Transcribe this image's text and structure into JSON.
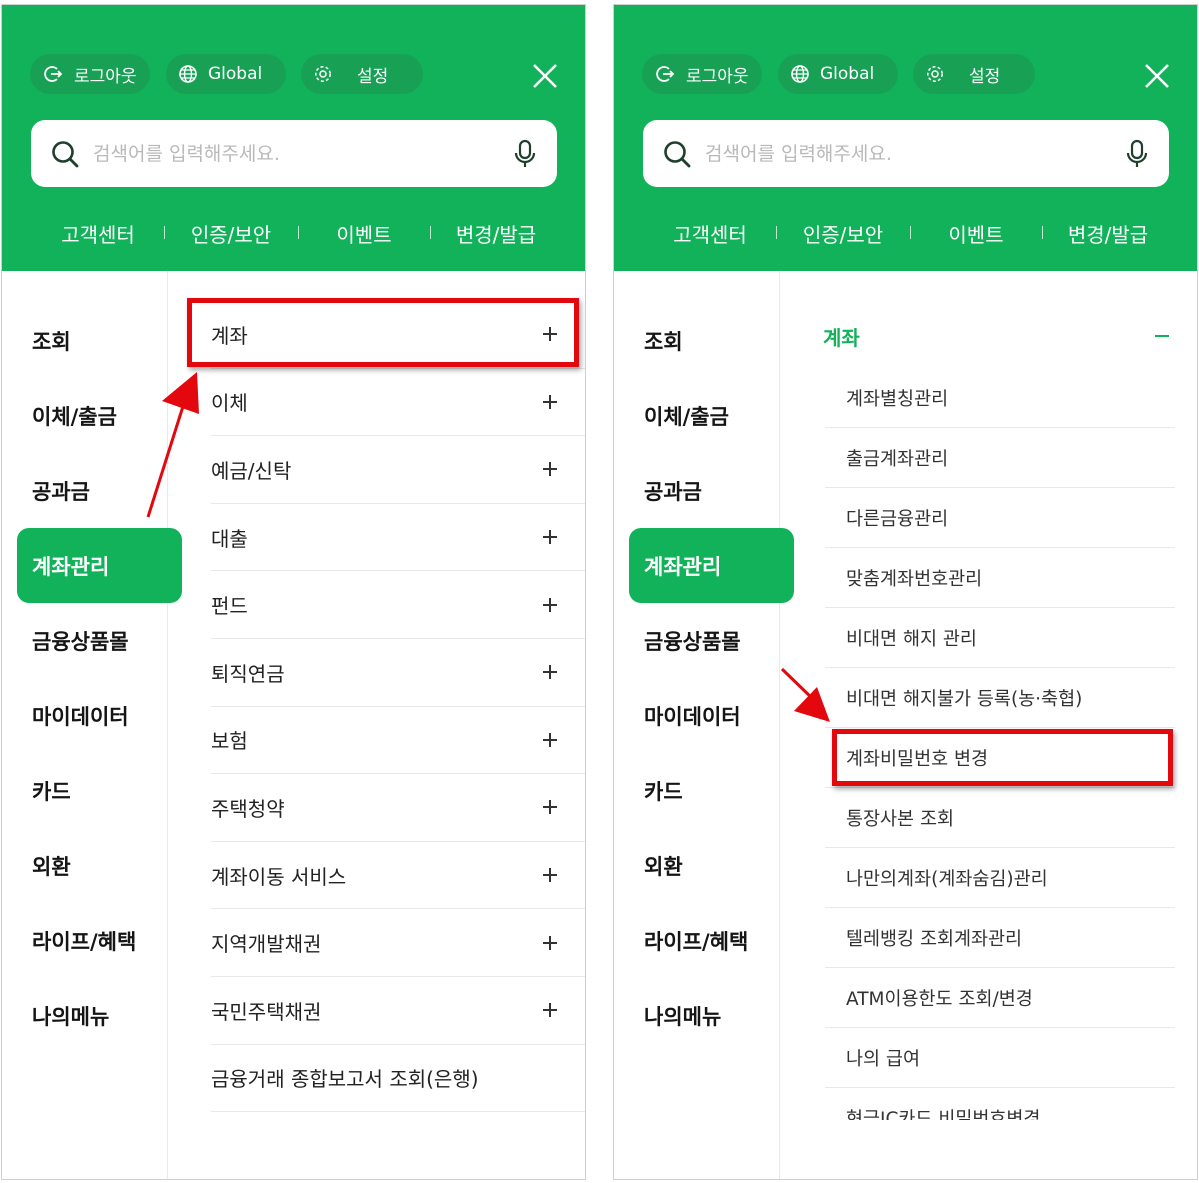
{
  "panels": {
    "left": {
      "header": {
        "logout": "로그아웃",
        "global": "Global",
        "settings": "설정",
        "search_placeholder": "검색어를 입력해주세요.",
        "quick_links": [
          "고객센터",
          "인증/보안",
          "이벤트",
          "변경/발급"
        ]
      },
      "menu": [
        "조회",
        "이체/출금",
        "공과금",
        "계좌관리",
        "금융상품몰",
        "마이데이터",
        "카드",
        "외환",
        "라이프/혜택",
        "나의메뉴"
      ],
      "active_menu": "계좌관리",
      "submenu": [
        "계좌",
        "이체",
        "예금/신탁",
        "대출",
        "펀드",
        "퇴직연금",
        "보험",
        "주택청약",
        "계좌이동 서비스",
        "지역개발채권",
        "국민주택채권",
        "금융거래 종합보고서 조회(은행)"
      ],
      "highlighted": "계좌"
    },
    "right": {
      "header": {
        "logout": "로그아웃",
        "global": "Global",
        "settings": "설정",
        "search_placeholder": "검색어를 입력해주세요.",
        "quick_links": [
          "고객센터",
          "인증/보안",
          "이벤트",
          "변경/발급"
        ]
      },
      "menu": [
        "조회",
        "이체/출금",
        "공과금",
        "계좌관리",
        "금융상품몰",
        "마이데이터",
        "카드",
        "외환",
        "라이프/혜택",
        "나의메뉴"
      ],
      "active_menu": "계좌관리",
      "open_section": "계좌",
      "section_items": [
        "계좌별칭관리",
        "출금계좌관리",
        "다른금융관리",
        "맞춤계좌번호관리",
        "비대면 해지 관리",
        "비대면 해지불가 등록(농·축협)",
        "계좌비밀번호 변경",
        "통장사본 조회",
        "나만의계좌(계좌숨김)관리",
        "텔레뱅킹 조회계좌관리",
        "ATM이용한도 조회/변경",
        "나의 급여",
        "현금IC카드 비밀번호변경"
      ],
      "highlighted": "계좌비밀번호 변경"
    }
  },
  "colors": {
    "brand_green": "#11b25a",
    "chip_green": "#18a155",
    "highlight_red": "#e3080d"
  }
}
